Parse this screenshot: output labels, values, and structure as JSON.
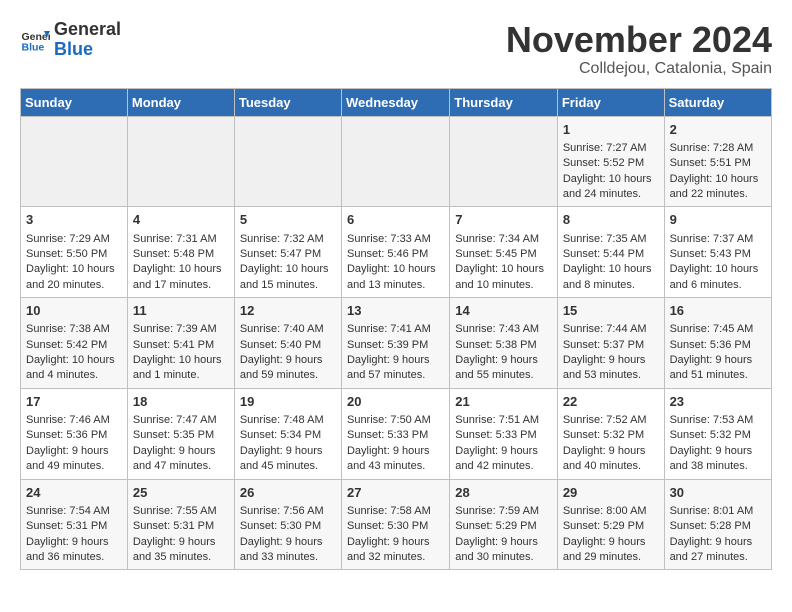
{
  "logo": {
    "line1": "General",
    "line2": "Blue"
  },
  "title": "November 2024",
  "subtitle": "Colldejou, Catalonia, Spain",
  "headers": [
    "Sunday",
    "Monday",
    "Tuesday",
    "Wednesday",
    "Thursday",
    "Friday",
    "Saturday"
  ],
  "weeks": [
    [
      {
        "day": "",
        "content": ""
      },
      {
        "day": "",
        "content": ""
      },
      {
        "day": "",
        "content": ""
      },
      {
        "day": "",
        "content": ""
      },
      {
        "day": "",
        "content": ""
      },
      {
        "day": "1",
        "content": "Sunrise: 7:27 AM\nSunset: 5:52 PM\nDaylight: 10 hours and 24 minutes."
      },
      {
        "day": "2",
        "content": "Sunrise: 7:28 AM\nSunset: 5:51 PM\nDaylight: 10 hours and 22 minutes."
      }
    ],
    [
      {
        "day": "3",
        "content": "Sunrise: 7:29 AM\nSunset: 5:50 PM\nDaylight: 10 hours and 20 minutes."
      },
      {
        "day": "4",
        "content": "Sunrise: 7:31 AM\nSunset: 5:48 PM\nDaylight: 10 hours and 17 minutes."
      },
      {
        "day": "5",
        "content": "Sunrise: 7:32 AM\nSunset: 5:47 PM\nDaylight: 10 hours and 15 minutes."
      },
      {
        "day": "6",
        "content": "Sunrise: 7:33 AM\nSunset: 5:46 PM\nDaylight: 10 hours and 13 minutes."
      },
      {
        "day": "7",
        "content": "Sunrise: 7:34 AM\nSunset: 5:45 PM\nDaylight: 10 hours and 10 minutes."
      },
      {
        "day": "8",
        "content": "Sunrise: 7:35 AM\nSunset: 5:44 PM\nDaylight: 10 hours and 8 minutes."
      },
      {
        "day": "9",
        "content": "Sunrise: 7:37 AM\nSunset: 5:43 PM\nDaylight: 10 hours and 6 minutes."
      }
    ],
    [
      {
        "day": "10",
        "content": "Sunrise: 7:38 AM\nSunset: 5:42 PM\nDaylight: 10 hours and 4 minutes."
      },
      {
        "day": "11",
        "content": "Sunrise: 7:39 AM\nSunset: 5:41 PM\nDaylight: 10 hours and 1 minute."
      },
      {
        "day": "12",
        "content": "Sunrise: 7:40 AM\nSunset: 5:40 PM\nDaylight: 9 hours and 59 minutes."
      },
      {
        "day": "13",
        "content": "Sunrise: 7:41 AM\nSunset: 5:39 PM\nDaylight: 9 hours and 57 minutes."
      },
      {
        "day": "14",
        "content": "Sunrise: 7:43 AM\nSunset: 5:38 PM\nDaylight: 9 hours and 55 minutes."
      },
      {
        "day": "15",
        "content": "Sunrise: 7:44 AM\nSunset: 5:37 PM\nDaylight: 9 hours and 53 minutes."
      },
      {
        "day": "16",
        "content": "Sunrise: 7:45 AM\nSunset: 5:36 PM\nDaylight: 9 hours and 51 minutes."
      }
    ],
    [
      {
        "day": "17",
        "content": "Sunrise: 7:46 AM\nSunset: 5:36 PM\nDaylight: 9 hours and 49 minutes."
      },
      {
        "day": "18",
        "content": "Sunrise: 7:47 AM\nSunset: 5:35 PM\nDaylight: 9 hours and 47 minutes."
      },
      {
        "day": "19",
        "content": "Sunrise: 7:48 AM\nSunset: 5:34 PM\nDaylight: 9 hours and 45 minutes."
      },
      {
        "day": "20",
        "content": "Sunrise: 7:50 AM\nSunset: 5:33 PM\nDaylight: 9 hours and 43 minutes."
      },
      {
        "day": "21",
        "content": "Sunrise: 7:51 AM\nSunset: 5:33 PM\nDaylight: 9 hours and 42 minutes."
      },
      {
        "day": "22",
        "content": "Sunrise: 7:52 AM\nSunset: 5:32 PM\nDaylight: 9 hours and 40 minutes."
      },
      {
        "day": "23",
        "content": "Sunrise: 7:53 AM\nSunset: 5:32 PM\nDaylight: 9 hours and 38 minutes."
      }
    ],
    [
      {
        "day": "24",
        "content": "Sunrise: 7:54 AM\nSunset: 5:31 PM\nDaylight: 9 hours and 36 minutes."
      },
      {
        "day": "25",
        "content": "Sunrise: 7:55 AM\nSunset: 5:31 PM\nDaylight: 9 hours and 35 minutes."
      },
      {
        "day": "26",
        "content": "Sunrise: 7:56 AM\nSunset: 5:30 PM\nDaylight: 9 hours and 33 minutes."
      },
      {
        "day": "27",
        "content": "Sunrise: 7:58 AM\nSunset: 5:30 PM\nDaylight: 9 hours and 32 minutes."
      },
      {
        "day": "28",
        "content": "Sunrise: 7:59 AM\nSunset: 5:29 PM\nDaylight: 9 hours and 30 minutes."
      },
      {
        "day": "29",
        "content": "Sunrise: 8:00 AM\nSunset: 5:29 PM\nDaylight: 9 hours and 29 minutes."
      },
      {
        "day": "30",
        "content": "Sunrise: 8:01 AM\nSunset: 5:28 PM\nDaylight: 9 hours and 27 minutes."
      }
    ]
  ]
}
